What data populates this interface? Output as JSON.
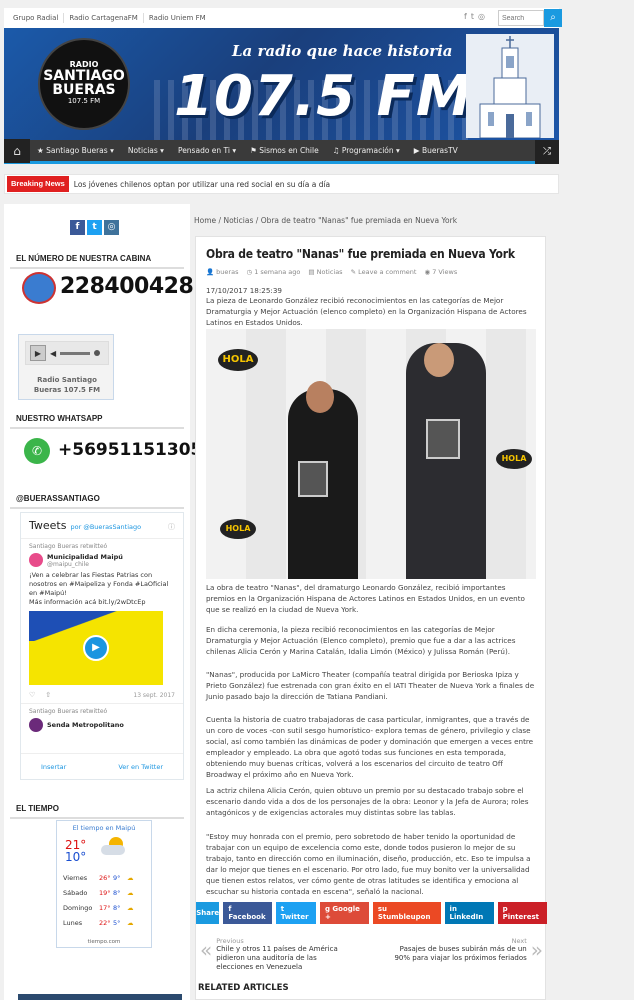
{
  "topbar": {
    "links": [
      "Grupo Radial",
      "Radio CartagenaFM",
      "Radio Uniem FM"
    ],
    "search_placeholder": "Search",
    "social_icons": [
      "facebook-icon",
      "twitter-icon",
      "instagram-icon"
    ]
  },
  "banner": {
    "logo_radio": "RADIO",
    "logo_line1": "SANTIAGO",
    "logo_line2": "BUERAS",
    "logo_freq": "107.5 FM",
    "slogan": "La radio que hace historia",
    "frequency": "107.5 FM"
  },
  "nav": {
    "items": [
      "Santiago Bueras",
      "Noticias",
      "Pensado en Ti",
      "Sismos en Chile",
      "Programación",
      "BuerasTV"
    ],
    "dropdown_flags": [
      true,
      true,
      true,
      false,
      true,
      false
    ]
  },
  "breaking": {
    "label": "Breaking News",
    "text": "Los jóvenes chilenos optan por utilizar una red social en su día a día"
  },
  "breadcrumb": {
    "home": "Home",
    "section": "Noticias",
    "current": "Obra de teatro \"Nanas\" fue premiada en Nueva York"
  },
  "sidebar": {
    "cabina_title": "El número de nuestra cabina",
    "cabina_number": "228400428",
    "player_station": "Radio Santiago Bueras 107.5 FM",
    "whatsapp_title": "Nuestro WhatsApp",
    "whatsapp_number": "+56951151305",
    "twitter_title": "@buerassantiago",
    "tweets_label": "Tweets",
    "tweets_by": "por @BuerasSantiago",
    "tweet1_retweet": "Santiago Bueras retwitteó",
    "tweet1_name": "Municipalidad Maipú",
    "tweet1_handle": "@maipu_chile",
    "tweet1_text": "¡Ven a celebrar las Fiestas Patrias con nosotros en #Maipeliza y Fonda #LaOficial en #Maipú!",
    "tweet1_more": "Más información acá bit.ly/2wDtcEp",
    "tweet1_date": "13 sept. 2017",
    "tweet2_retweet": "Santiago Bueras retwitteó",
    "tweet2_name": "Senda Metropolitano",
    "insert_label": "Insertar",
    "view_label": "Ver en Twitter",
    "weather_title": "El tiempo",
    "weather_header": "El tiempo en Maipú",
    "weather_high": "21°",
    "weather_low": "10°",
    "forecast": [
      {
        "day": "Viernes",
        "high": "26°",
        "low": "9°"
      },
      {
        "day": "Sábado",
        "high": "19°",
        "low": "8°"
      },
      {
        "day": "Domingo",
        "high": "17°",
        "low": "8°"
      },
      {
        "day": "Lunes",
        "high": "22°",
        "low": "5°"
      }
    ],
    "weather_footer": "tiempo.com"
  },
  "article": {
    "title": "Obra de teatro \"Nanas\" fue premiada en Nueva York",
    "author": "bueras",
    "time": "1 semana ago",
    "category": "Noticias",
    "comment": "Leave a comment",
    "views": "7 Views",
    "date": "17/10/2017 18:25:39",
    "lead": "La pieza de Leonardo González recibió reconocimientos en las categorías de Mejor Dramaturgia y Mejor Actuación (elenco completo) en la Organización Hispana de Actores Latinos en Estados Unidos.",
    "p1": "La obra de teatro \"Nanas\", del dramaturgo Leonardo González, recibió importantes premios en la Organización Hispana de Actores Latinos en Estados Unidos, en un evento que se realizó en la ciudad de Nueva York.",
    "p2": "En dicha ceremonia, la pieza recibió reconocimientos en las categorías de Mejor Dramaturgia y Mejor Actuación (Elenco completo), premio que fue a dar a las actrices chilenas Alicia Cerón y Marina Catalán, Idalia Limón (México) y Julissa Román (Perú).",
    "p3": "\"Nanas\", producida por LaMicro Theater (compañía teatral dirigida por Berioska Ipiza y Prieto González) fue estrenada con gran éxito en el IATI Theater de Nueva York a finales de Junio pasado bajo la dirección de Tatiana Pandiani.",
    "p4": "Cuenta la historia de cuatro trabajadoras de casa particular, inmigrantes, que a través de un coro de voces -con sutil sesgo humorístico- explora temas de género, privilegio y clase social, así como también las dinámicas de poder y dominación que emergen a veces entre empleador y empleado. La obra que agotó todas sus funciones en esta temporada, obteniendo muy buenas críticas, volverá a los escenarios del circuito de teatro Off Broadway el próximo año en Nueva York.",
    "p5": "La actriz chilena Alicia Cerón, quien obtuvo un premio por su destacado trabajo sobre el escenario dando vida a dos de los personajes de la obra: Leonor y la Jefa de Aurora; roles antagónicos y de exigencias actorales muy distintas sobre las tablas.",
    "p6": "\"Estoy muy honrada con el premio, pero sobretodo de haber tenido la oportunidad de trabajar con un equipo de excelencia como este, donde todos pusieron lo mejor de su trabajo, tanto en dirección como en iluminación, diseño, producción, etc. Eso te impulsa a dar lo mejor que tienes en el escenario. Por otro lado, fue muy bonito ver la universalidad que tienen estos relatos, ver cómo gente de otras latitudes se identifica y emociona al escuchar su historia contada en escena\", señaló la nacional."
  },
  "share": {
    "label": "Share",
    "buttons": [
      {
        "label": "Facebook",
        "color": "#3b5998"
      },
      {
        "label": "Twitter",
        "color": "#1da1f2"
      },
      {
        "label": "Google +",
        "color": "#dd4b39"
      },
      {
        "label": "Stumbleupon",
        "color": "#eb4924"
      },
      {
        "label": "LinkedIn",
        "color": "#0077b5"
      },
      {
        "label": "Pinterest",
        "color": "#cb2027"
      }
    ]
  },
  "postnav": {
    "prev_label": "Previous",
    "prev_title": "Chile y otros 11 países de América pidieron una auditoría de las elecciones en Venezuela",
    "next_label": "Next",
    "next_title": "Pasajes de buses subirán más de un 90% para viajar los próximos feriados"
  },
  "related_title": "Related Articles",
  "colors": {
    "accent": "#1a9ae0",
    "breaking": "#e02020",
    "nav_bg": "#3a3a3a"
  }
}
